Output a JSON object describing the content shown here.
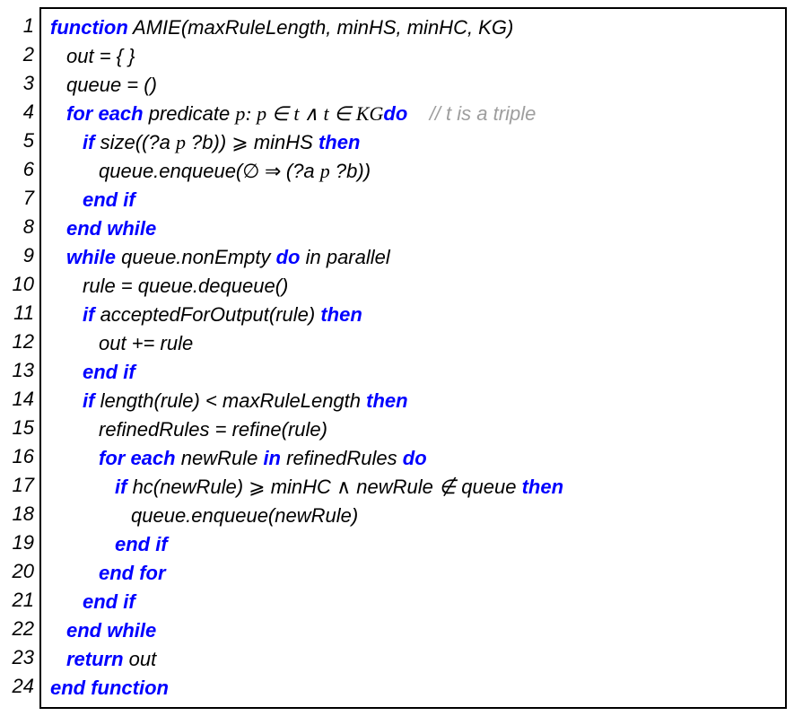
{
  "kw": {
    "function": "function",
    "foreach": "for each",
    "do": "do",
    "if": "if",
    "then": "then",
    "endif": "end if",
    "endwhile": "end while",
    "while": "while",
    "in": "in",
    "endfor": "end for",
    "return": "return",
    "endfunction": "end function"
  },
  "code": {
    "fnSig": " AMIE(maxRuleLength, minHS, minHC, KG)",
    "outInit": "out = { }",
    "queueInit": "queue = ()",
    "predicate": " predicate ",
    "p": "p",
    "forCond": "  :   p  ∈  t  ∧  t  ∈   KG ",
    "inParallel": " in parallel",
    "sizeOpen": " size((?a ",
    "sizeClose": " ?b)) ",
    "ge": "⩾",
    "minHS": " minHS ",
    "enqueue1a": "queue.enqueue(",
    "empty": "∅",
    "implies": " ⇒ ",
    "enqueue1b": "(?a ",
    "enqueue1c": " ?b))",
    "whileCond": " queue.nonEmpty ",
    "dequeue": "rule = queue.dequeue()",
    "acceptedOpen": " acceptedForOutput(rule) ",
    "outAdd": "out += rule",
    "lenCond": " length(rule) < maxRuleLength ",
    "refineCall": "refinedRules = refine(rule)",
    "newRule": " newRule ",
    "refinedRules": " refinedRules ",
    "hcOpen": " hc(newRule) ",
    "minHCAnd": " minHC ",
    "and": "∧",
    "notin": " newRule ∉ queue ",
    "enqueue2": "queue.enqueue(newRule)",
    "retOut": " out"
  },
  "comment": {
    "triple": "// t is a triple"
  },
  "linenos": [
    "1",
    "2",
    "3",
    "4",
    "5",
    "6",
    "7",
    "8",
    "9",
    "10",
    "11",
    "12",
    "13",
    "14",
    "15",
    "16",
    "17",
    "18",
    "19",
    "20",
    "21",
    "22",
    "23",
    "24"
  ]
}
